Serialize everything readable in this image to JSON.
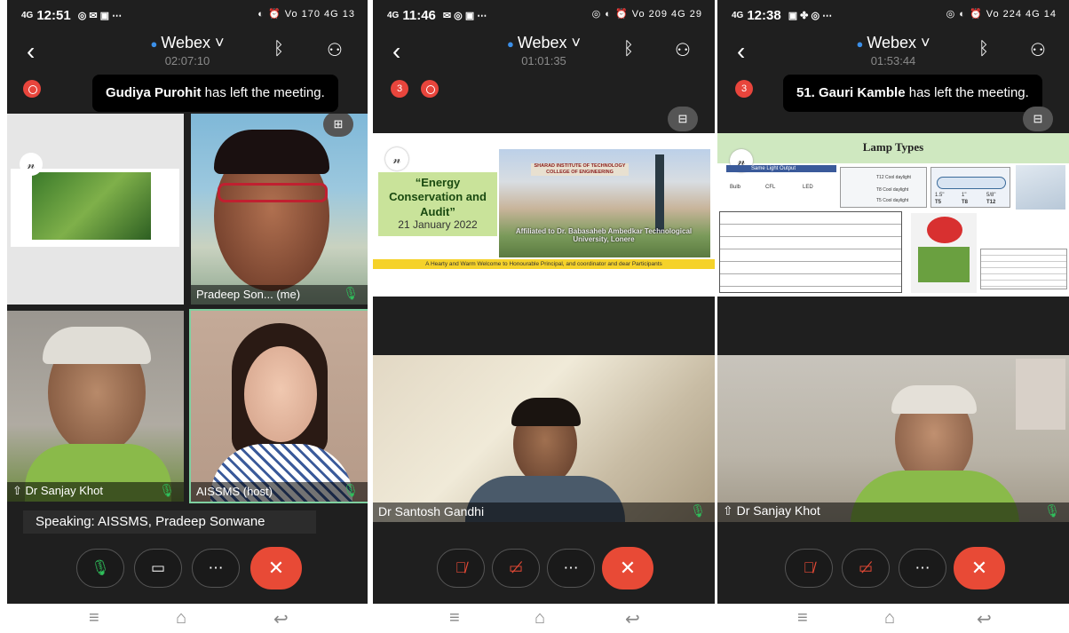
{
  "phones": [
    {
      "status": {
        "time": "12:51",
        "right": "Vo 170 4G 13"
      },
      "header": {
        "title": "Webex",
        "timer": "02:07:10"
      },
      "toast": {
        "name": "Gudiya Purohit",
        "msg": " has left the meeting."
      },
      "tiles": [
        {
          "name": ""
        },
        {
          "name": "Pradeep Son... (me)"
        },
        {
          "name": "Dr Sanjay Khot"
        },
        {
          "name": "AISSMS (host)"
        }
      ],
      "speaking": "Speaking: AISSMS, Pradeep Sonwane"
    },
    {
      "status": {
        "time": "11:46",
        "right": "Vo 209 4G 29"
      },
      "header": {
        "title": "Webex",
        "timer": "01:01:35"
      },
      "slide": {
        "box_text": "“Energy Conservation and Audit”",
        "date": "21 January 2022",
        "college": "SHARAD INSTITUTE OF TECHNOLOGY COLLEGE OF ENGINEERING",
        "affiliation": "Affiliated to Dr. Babasaheb Ambedkar Technological University, Lonere",
        "banner": "A Hearty and Warm Welcome to Honourable Principal, and coordinator and dear Participants"
      },
      "tile_name": "Dr Santosh Gandhi"
    },
    {
      "status": {
        "time": "12:38",
        "right": "Vo 224 4G 14"
      },
      "header": {
        "title": "Webex",
        "timer": "01:53:44"
      },
      "toast": {
        "name": "51. Gauri Kamble",
        "msg": " has left the meeting."
      },
      "slide": {
        "title": "Lamp Types",
        "sub": "Same Light Output",
        "bulb_labels": [
          "Bulb",
          "CFL",
          "LED"
        ],
        "tube_labels": [
          "T12 Cool daylight",
          "T8 Cool daylight",
          "T5 Cool daylight"
        ],
        "tube_sizes": [
          "1.5\"",
          "1\"",
          "5/8\""
        ],
        "tube_numbers": [
          "T5",
          "T8",
          "T12"
        ]
      },
      "tile_name": "Dr Sanjay Khot"
    }
  ],
  "colors": {
    "end_call": "#e84a36",
    "mic_on": "#2fbf5b",
    "webex_dot": "#3b8fe8",
    "bg": "#1f1f1f"
  }
}
